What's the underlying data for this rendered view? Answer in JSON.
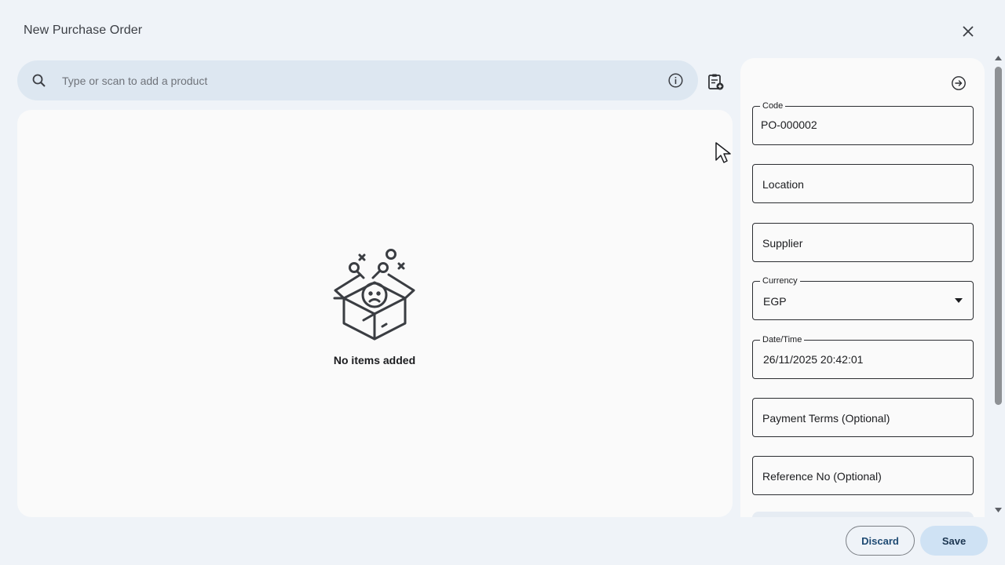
{
  "dialog": {
    "title": "New Purchase Order"
  },
  "search": {
    "placeholder": "Type or scan to add a product"
  },
  "items": {
    "empty_text": "No items added"
  },
  "form": {
    "code_label": "Code",
    "code_value": "PO-000002",
    "location_placeholder": "Location",
    "supplier_placeholder": "Supplier",
    "currency_label": "Currency",
    "currency_value": "EGP",
    "datetime_label": "Date/Time",
    "datetime_value": "26/11/2025 20:42:01",
    "payment_terms_placeholder": "Payment Terms (Optional)",
    "reference_placeholder": "Reference No (Optional)"
  },
  "actions": {
    "discard_label": "Discard",
    "save_label": "Save"
  },
  "icons": {
    "close": "close-icon",
    "search": "search-icon",
    "info": "info-icon",
    "clipboard_add": "clipboard-add-icon",
    "collapse": "arrow-right-circle-icon",
    "empty_box": "empty-box-icon"
  },
  "colors": {
    "accent": "#cfe2f4",
    "surface": "#fafafa",
    "background": "#eff3f8",
    "search_bg": "#dde7f1"
  }
}
